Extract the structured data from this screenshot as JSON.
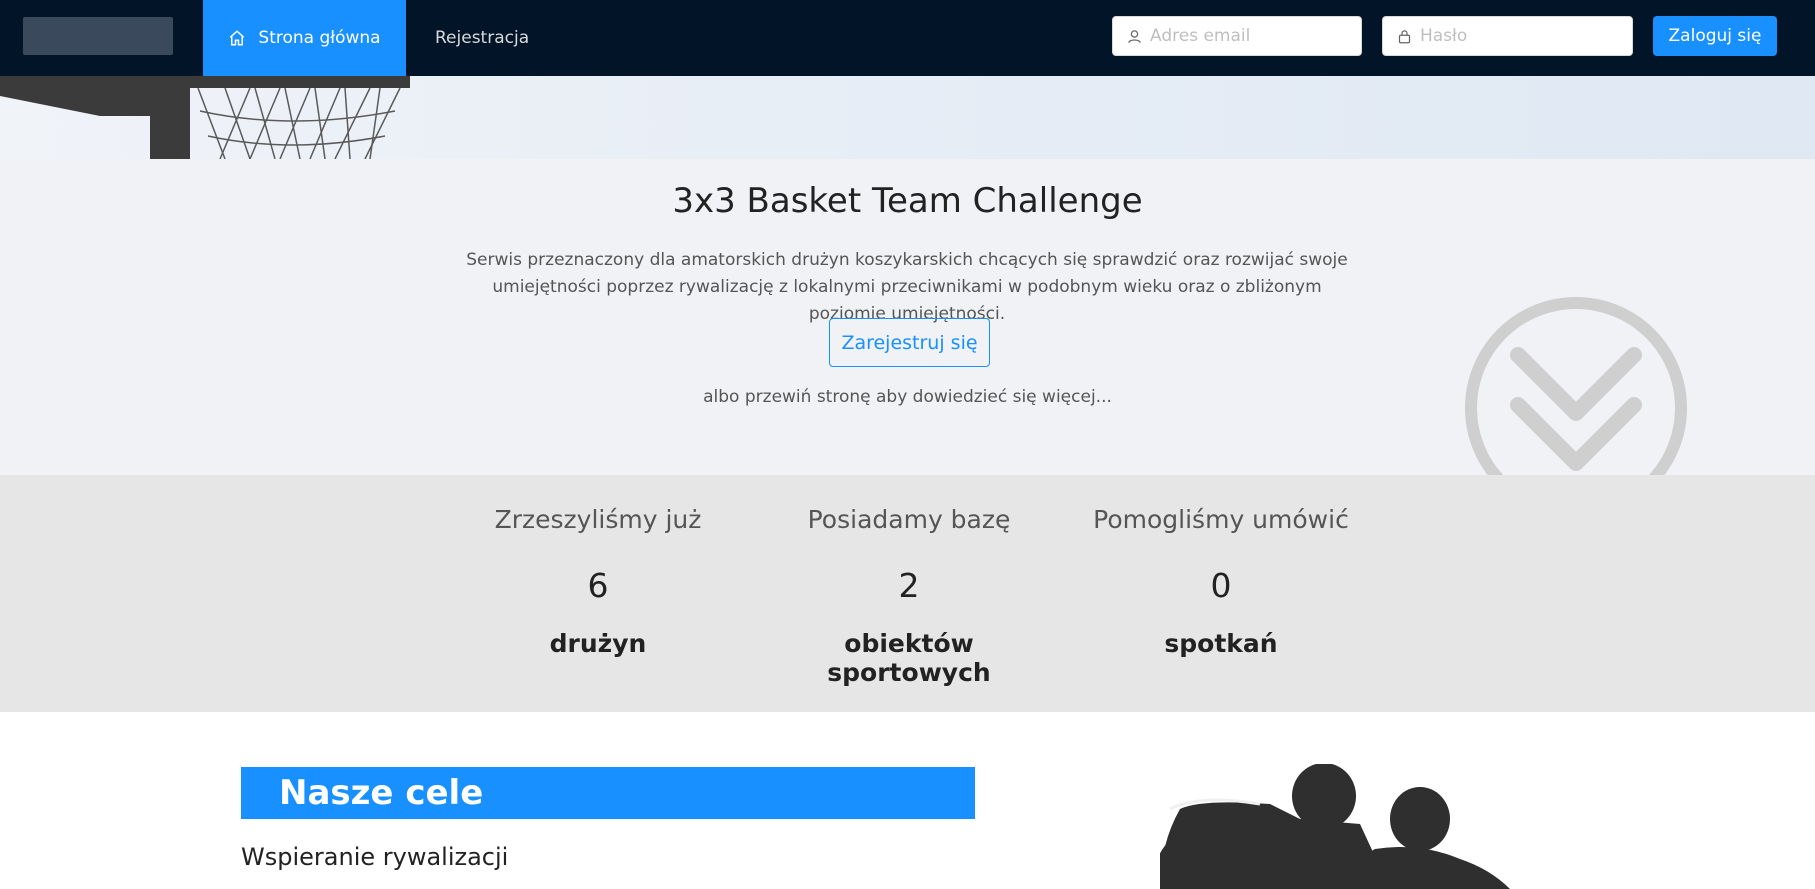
{
  "nav": {
    "home_label": "Strona główna",
    "register_label": "Rejestracja",
    "email_placeholder": "Adres email",
    "password_placeholder": "Hasło",
    "login_label": "Zaloguj się"
  },
  "intro": {
    "title": "3x3 Basket Team Challenge",
    "description": "Serwis przeznaczony dla amatorskich drużyn koszykarskich chcących się sprawdzić oraz rozwijać swoje umiejętności poprzez rywalizację z lokalnymi przeciwnikami w podobnym wieku oraz o zbliżonym poziomie umiejętności.",
    "register_button": "Zarejestruj się",
    "scroll_hint": "albo przewiń stronę aby dowiedzieć się więcej..."
  },
  "stats": [
    {
      "heading": "Zrzeszyliśmy już",
      "value": "6",
      "unit": "drużyn"
    },
    {
      "heading": "Posiadamy bazę",
      "value": "2",
      "unit": "obiektów sportowych"
    },
    {
      "heading": "Pomogliśmy umówić",
      "value": "0",
      "unit": "spotkań"
    }
  ],
  "goals": {
    "title": "Nasze cele",
    "subtitle": "Wspieranie rywalizacji"
  },
  "colors": {
    "nav_bg": "#011428",
    "accent": "#1890ff",
    "intro_bg": "#f0f2f5",
    "stats_bg": "#e6e6e6"
  },
  "icons": [
    "home-icon",
    "user-icon",
    "lock-icon",
    "chevron-down-circle-icon"
  ]
}
